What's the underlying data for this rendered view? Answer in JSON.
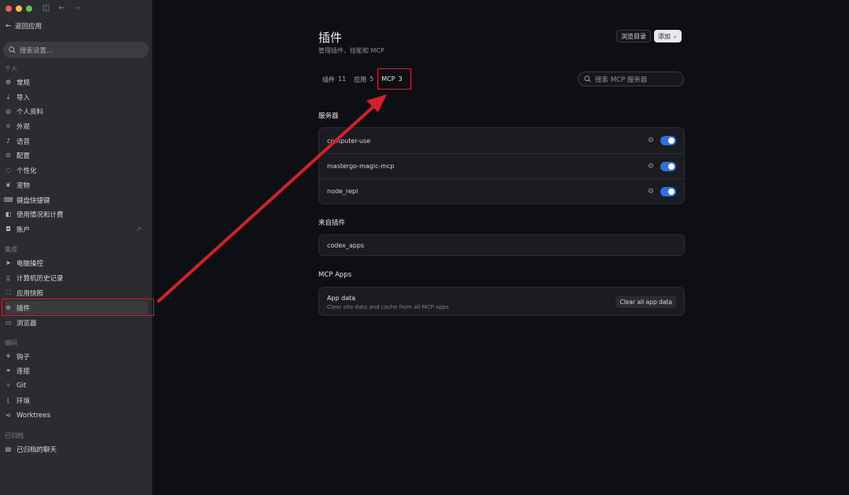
{
  "window": {
    "nav_icons": [
      "sidebar-toggle-icon",
      "back-arrow-icon",
      "forward-arrow-icon"
    ]
  },
  "sidebar": {
    "back_label": "返回应用",
    "search_placeholder": "搜索设置...",
    "sections": [
      {
        "title": "个人",
        "items": [
          {
            "label": "常规",
            "icon": "gear-icon"
          },
          {
            "label": "导入",
            "icon": "import-icon"
          },
          {
            "label": "个人资料",
            "icon": "profile-icon"
          },
          {
            "label": "外观",
            "icon": "appearance-icon"
          },
          {
            "label": "语音",
            "icon": "mic-icon"
          },
          {
            "label": "配置",
            "icon": "config-icon"
          },
          {
            "label": "个性化",
            "icon": "personalize-icon"
          },
          {
            "label": "宠物",
            "icon": "pet-icon"
          },
          {
            "label": "键盘快捷键",
            "icon": "keyboard-icon"
          },
          {
            "label": "使用情况和计费",
            "icon": "billing-icon"
          },
          {
            "label": "账户",
            "icon": "account-icon"
          }
        ]
      },
      {
        "title": "集成",
        "items": [
          {
            "label": "电脑操控",
            "icon": "computer-control-icon"
          },
          {
            "label": "计算机历史记录",
            "icon": "history-icon"
          },
          {
            "label": "应用快照",
            "icon": "snapshot-icon"
          },
          {
            "label": "插件",
            "icon": "plugin-icon"
          },
          {
            "label": "浏览器",
            "icon": "browser-icon"
          }
        ]
      },
      {
        "title": "编码",
        "items": [
          {
            "label": "钩子",
            "icon": "hook-icon"
          },
          {
            "label": "连接",
            "icon": "link-icon"
          },
          {
            "label": "Git",
            "icon": "git-icon"
          },
          {
            "label": "环境",
            "icon": "environment-icon"
          },
          {
            "label": "Worktrees",
            "icon": "worktree-icon"
          }
        ]
      },
      {
        "title": "已归档",
        "items": [
          {
            "label": "已归档的聊天",
            "icon": "archive-icon"
          }
        ]
      }
    ]
  },
  "main": {
    "title": "插件",
    "subtitle": "管理插件、技能和 MCP",
    "browse_button": "浏览目录",
    "add_button": "添加",
    "tabs": [
      {
        "label": "插件",
        "count": "11"
      },
      {
        "label": "应用",
        "count": "5"
      },
      {
        "label": "MCP",
        "count": "3"
      }
    ],
    "search_placeholder": "搜索 MCP 服务器",
    "servers_title": "服务器",
    "servers": [
      {
        "name": "computer-use",
        "enabled": true
      },
      {
        "name": "mastergo-magic-mcp",
        "enabled": true
      },
      {
        "name": "node_repl",
        "enabled": true
      }
    ],
    "from_plugins_title": "来自插件",
    "plugin_servers": [
      {
        "name": "codex_apps"
      }
    ],
    "mcp_apps_title": "MCP Apps",
    "app_data": {
      "title": "App data",
      "description": "Clear site data and cache from all MCP apps",
      "button": "Clear all app data"
    }
  },
  "colors": {
    "highlight_red": "#d4202a",
    "toggle_blue": "#2f6fdf",
    "sidebar_bg": "#2b2c2f",
    "main_bg": "#0d0f14"
  }
}
